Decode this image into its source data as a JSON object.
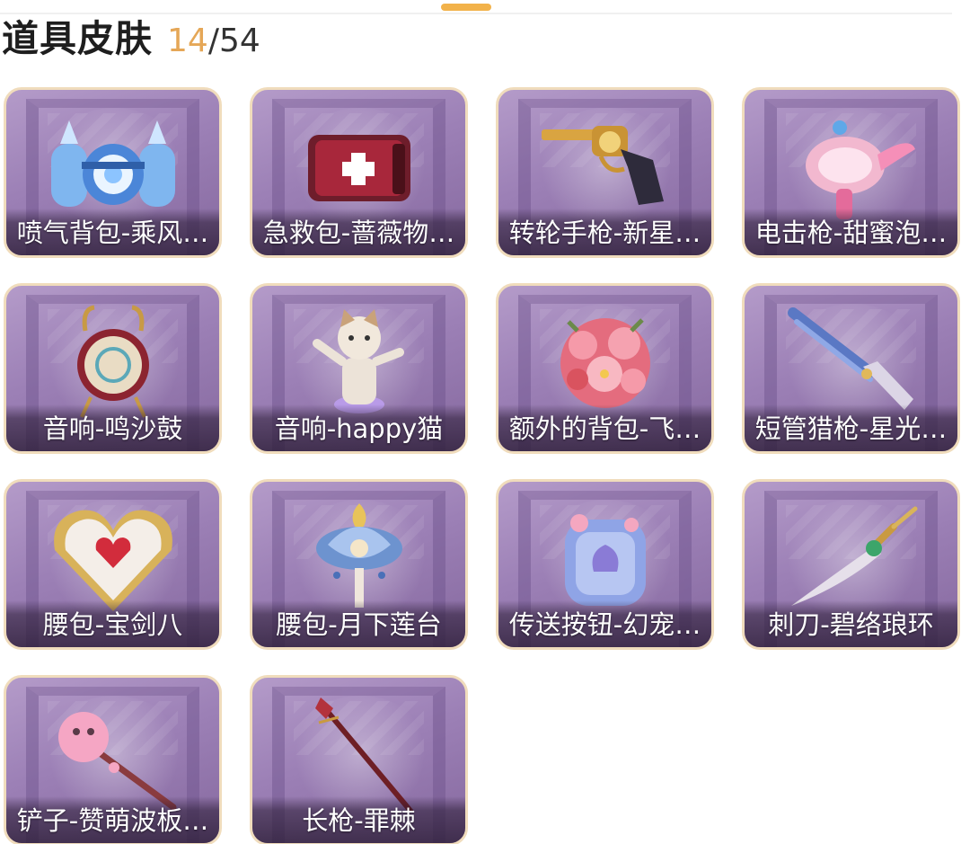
{
  "header": {
    "title": "道具皮肤",
    "owned": "14",
    "separator": "/",
    "total": "54"
  },
  "colors": {
    "accent": "#e5a757",
    "card_border": "#f0dcbc",
    "card_bg": "#9c80b6",
    "handle": "#f2b24a"
  },
  "items": [
    {
      "label": "喷气背包-乘风…",
      "icon": "jetpack-icon"
    },
    {
      "label": "急救包-蔷薇物…",
      "icon": "first-aid-kit-icon"
    },
    {
      "label": "转轮手枪-新星…",
      "icon": "revolver-icon"
    },
    {
      "label": "电击枪-甜蜜泡…",
      "icon": "stun-gun-icon"
    },
    {
      "label": "音响-鸣沙鼓",
      "icon": "drum-speaker-icon"
    },
    {
      "label": "音响-happy猫",
      "icon": "cat-speaker-icon"
    },
    {
      "label": "额外的背包-飞…",
      "icon": "flower-backpack-icon"
    },
    {
      "label": "短管猎枪-星光…",
      "icon": "shotgun-icon"
    },
    {
      "label": "腰包-宝剑八",
      "icon": "heart-waist-pack-icon"
    },
    {
      "label": "腰包-月下莲台",
      "icon": "lotus-waist-pack-icon"
    },
    {
      "label": "传送按钮-幻宠…",
      "icon": "teleport-button-icon"
    },
    {
      "label": "刺刀-碧络琅环",
      "icon": "dagger-icon"
    },
    {
      "label": "铲子-赞萌波板…",
      "icon": "shovel-icon"
    },
    {
      "label": "长枪-罪棘",
      "icon": "spear-icon"
    }
  ]
}
